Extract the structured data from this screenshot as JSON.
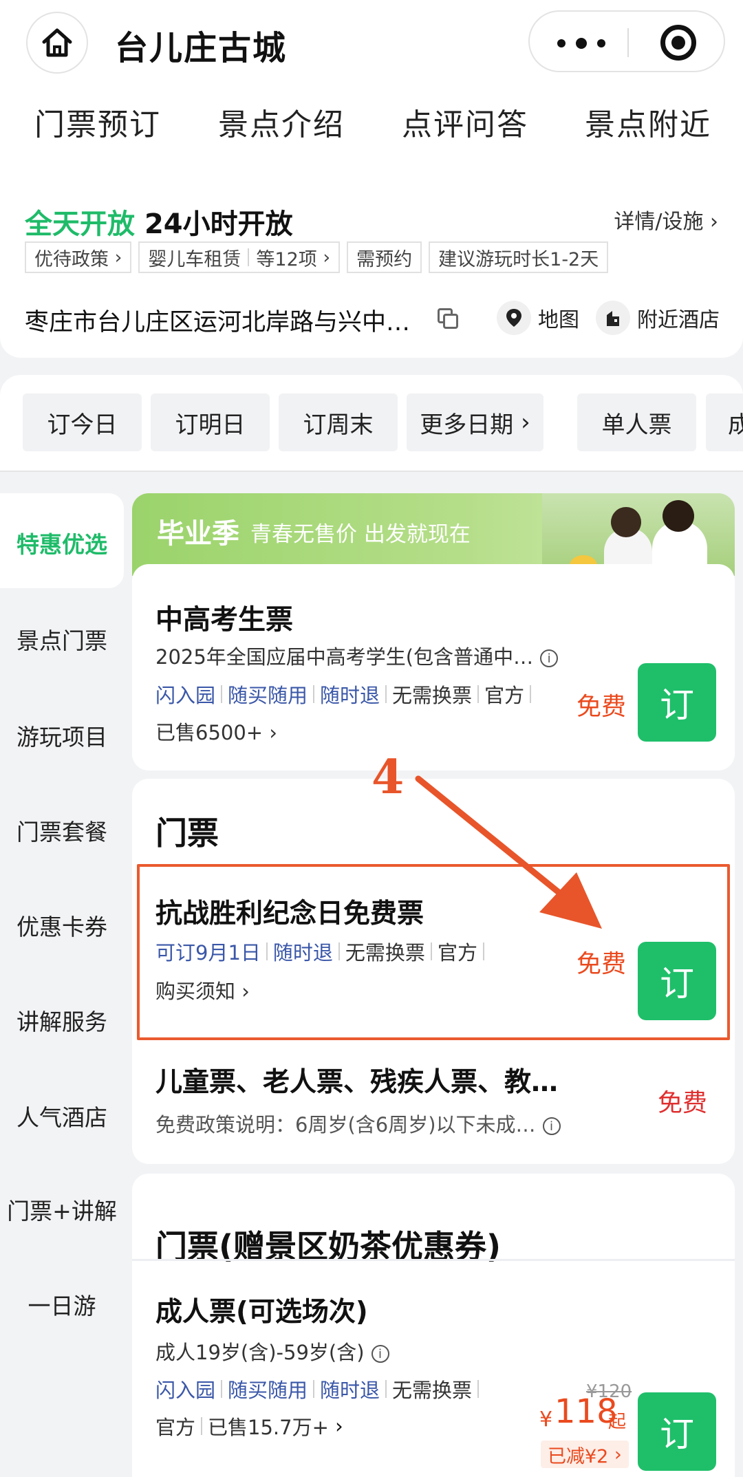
{
  "header": {
    "title": "台儿庄古城",
    "tabs": [
      "门票预订",
      "景点介绍",
      "点评问答",
      "景点附近"
    ]
  },
  "info": {
    "open_status": "全天开放",
    "open_hours": "24小时开放",
    "detail_link": "详情/设施",
    "chips": [
      "优待政策",
      "婴儿车租赁",
      "等12项",
      "需预约",
      "建议游玩时长1-2天"
    ],
    "address": "枣庄市台儿庄区运河北岸路与兴中…",
    "map_label": "地图",
    "hotel_label": "附近酒店"
  },
  "dates": [
    "订今日",
    "订明日",
    "订周末",
    "更多日期",
    "单人票",
    "成"
  ],
  "sidebar": {
    "items": [
      "特惠优选",
      "景点门票",
      "游玩项目",
      "门票套餐",
      "优惠卡券",
      "讲解服务",
      "人气酒店",
      "门票+讲解",
      "一日游"
    ]
  },
  "promo": {
    "big": "毕业季",
    "small": "青春无售价 出发就现在"
  },
  "student_ticket": {
    "title": "中高考生票",
    "desc": "2025年全国应届中高考学生(包含普通中…",
    "tags_blue": [
      "闪入园",
      "随买随用",
      "随时退"
    ],
    "tags_gray": [
      "无需换票",
      "官方"
    ],
    "sold": "已售6500+",
    "price": "免费",
    "book": "订"
  },
  "section_tickets": {
    "heading": "门票",
    "victory": {
      "title": "抗战胜利纪念日免费票",
      "tags_blue": [
        "可订9月1日",
        "随时退"
      ],
      "tags_gray": [
        "无需换票",
        "官方"
      ],
      "notice": "购买须知",
      "price": "免费",
      "book": "订"
    },
    "concession": {
      "title": "儿童票、老人票、残疾人票、教…",
      "desc": "免费政策说明：6周岁(含6周岁)以下未成…",
      "price": "免费"
    }
  },
  "annotation": {
    "step": "4"
  },
  "section_milk": {
    "heading": "门票(赠景区奶茶优惠券)",
    "adult": {
      "title": "成人票(可选场次)",
      "desc": "成人19岁(含)-59岁(含)",
      "tags_blue": [
        "闪入园",
        "随买随用",
        "随时退"
      ],
      "tags_gray": [
        "无需换票"
      ],
      "official": "官方",
      "sold": "已售15.7万+",
      "original_price": "¥120",
      "currency": "¥",
      "price": "118",
      "price_suffix": "起",
      "discount": "已减¥2",
      "book": "订"
    }
  },
  "colors": {
    "accent_green": "#1fbf6a",
    "accent_orange": "#ea4a1e",
    "tag_blue": "#3a57a8"
  }
}
